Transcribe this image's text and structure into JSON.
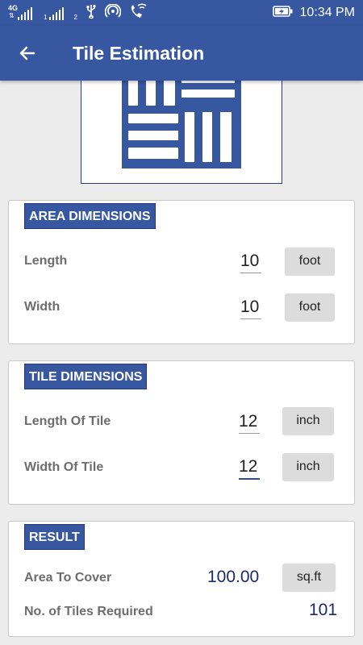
{
  "status_bar": {
    "network_type": "4G",
    "sim1_index": "1",
    "sim2_index": "2",
    "time": "10:34 PM",
    "icons": [
      "signal-icon",
      "usb-icon",
      "hotspot-icon",
      "wifi-call-icon",
      "battery-charging-icon"
    ]
  },
  "toolbar": {
    "title": "Tile Estimation",
    "back_icon": "arrow-left-icon"
  },
  "area": {
    "heading": "AREA DIMENSIONS",
    "length_label": "Length",
    "length_value": "10",
    "length_unit": "foot",
    "width_label": "Width",
    "width_value": "10",
    "width_unit": "foot"
  },
  "tile": {
    "heading": "TILE DIMENSIONS",
    "length_label": "Length Of Tile",
    "length_value": "12",
    "length_unit": "inch",
    "width_label": "Width Of Tile",
    "width_value": "12",
    "width_unit": "inch"
  },
  "result": {
    "heading": "RESULT",
    "area_label": "Area To Cover",
    "area_value": "100.00",
    "area_unit": "sq.ft",
    "tiles_label": "No. of Tiles Required",
    "tiles_value": "101"
  },
  "colors": {
    "primary": "#3757a0",
    "accent": "#2d4a9a",
    "result_text": "#1a2a6e",
    "label_gray": "#6d6d6d",
    "background": "#ececec"
  }
}
